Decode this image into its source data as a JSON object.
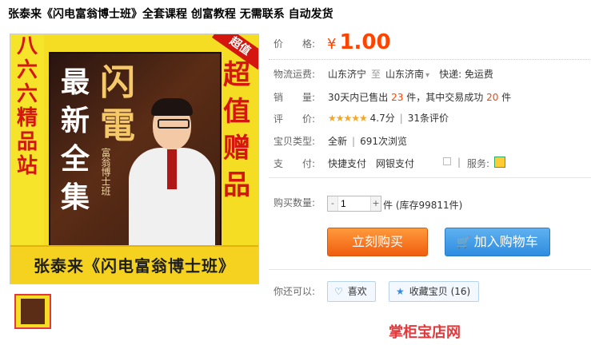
{
  "page_title": "张泰来《闪电富翁博士班》全套课程 创富教程 无需联系 自动发货",
  "image": {
    "left_banner": [
      "八",
      "六",
      "六",
      "精",
      "品",
      "站"
    ],
    "box_left": [
      "最",
      "新",
      "全",
      "集"
    ],
    "box_title_big": "闪電",
    "box_title_small": "富翁博士班",
    "right_col": [
      "超",
      "值",
      "赠",
      "品"
    ],
    "corner_badge": "超值",
    "bottom_banner": "张泰来《闪电富翁博士班》"
  },
  "price": {
    "label": "价　　格:",
    "currency": "¥",
    "value": "1.00"
  },
  "shipping": {
    "label": "物流运费:",
    "from": "山东济宁",
    "sep": "至",
    "to": "山东济南",
    "arrow": "▾",
    "fee": "快递: 免运费"
  },
  "sales": {
    "label": "销　　量:",
    "prefix": "30天内已售出",
    "sold": "23",
    "mid": "件，其中交易成功",
    "success": "20",
    "suffix": "件"
  },
  "rating": {
    "label": "评　　价:",
    "stars": "★★★★★",
    "score": "4.7分",
    "count": "31条评价"
  },
  "type": {
    "label": "宝贝类型:",
    "condition": "全新",
    "views": "691次浏览"
  },
  "payment": {
    "label": "支　　付:",
    "methods": "快捷支付　网银支付",
    "service_label": "服务:"
  },
  "quantity": {
    "label": "购买数量:",
    "minus": "-",
    "value": "1",
    "plus": "+",
    "unit_stock": "件 (库存99811件)"
  },
  "buttons": {
    "buy": "立刻购买",
    "cart_icon": "🛒",
    "cart": "加入购物车"
  },
  "actions": {
    "label": "你还可以:",
    "like_icon": "♡",
    "like": "喜欢",
    "fav_icon": "★",
    "fav": "收藏宝贝 (16)"
  },
  "shop_link": "掌柜宝店网"
}
